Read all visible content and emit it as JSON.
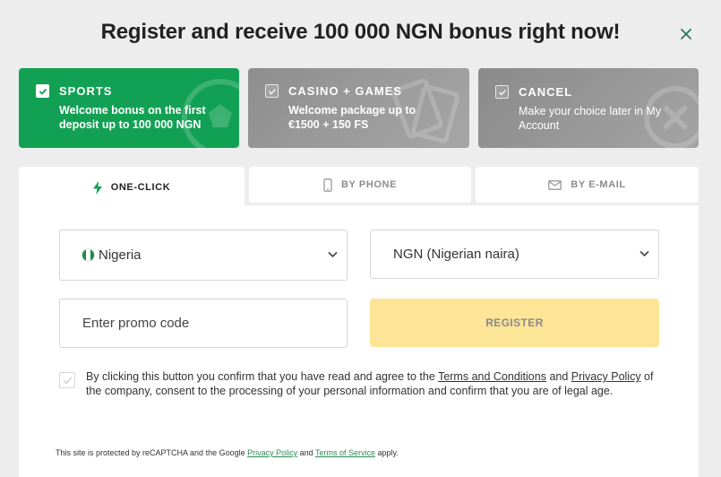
{
  "title": "Register and receive 100 000 NGN bonus right now!",
  "icons": {
    "close": "close-icon",
    "bolt": "lightning-icon",
    "phone": "phone-icon",
    "email": "envelope-icon",
    "check": "checkmark-icon"
  },
  "colors": {
    "sports_green": "#12a154",
    "register_yellow": "#fce596",
    "link_green": "#2e8b57"
  },
  "bonus_cards": [
    {
      "title": "SPORTS",
      "description": "Welcome bonus on the first deposit up to 100 000 NGN",
      "selected": true
    },
    {
      "title": "CASINO + GAMES",
      "description": "Welcome package up to €1500 + 150 FS",
      "selected": false
    },
    {
      "title": "CANCEL",
      "description": "Make your choice later in My Account",
      "selected": false
    }
  ],
  "tabs": [
    {
      "label": "ONE-CLICK",
      "active": true
    },
    {
      "label": "BY PHONE",
      "active": false
    },
    {
      "label": "BY E-MAIL",
      "active": false
    }
  ],
  "form": {
    "country": "Nigeria",
    "currency": "NGN (Nigerian naira)",
    "promo_placeholder": "Enter promo code",
    "register_label": "REGISTER"
  },
  "consent": {
    "before": "By clicking this button you confirm that you have read and agree to the ",
    "terms_link": "Terms and Conditions",
    "and": " and ",
    "privacy_link": "Privacy Policy",
    "after": " of the company, consent to the processing of your personal information and confirm that you are of legal age."
  },
  "recaptcha": {
    "before": "This site is protected by reCAPTCHA and the Google ",
    "privacy_link": "Privacy Policy",
    "and": " and ",
    "terms_link": "Terms of Service",
    "after": " apply."
  }
}
